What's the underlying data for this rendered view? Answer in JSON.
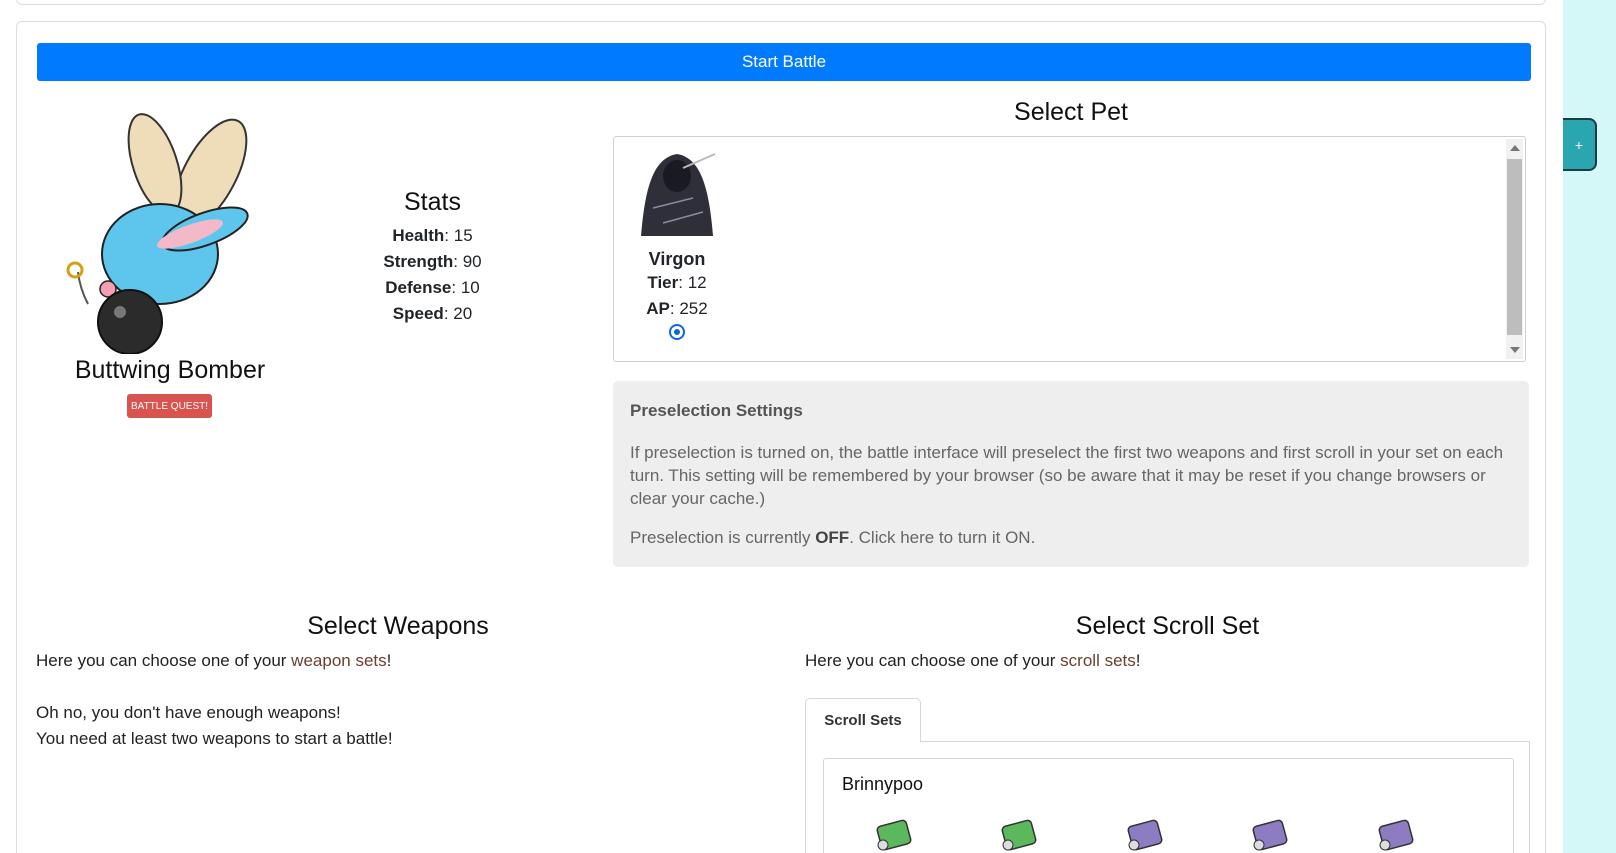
{
  "battle": {
    "start_label": "Start Battle"
  },
  "monster": {
    "name": "Buttwing Bomber",
    "quest_label": "BATTLE QUEST!",
    "stats_title": "Stats",
    "stats": [
      {
        "label": "Health",
        "value": "15"
      },
      {
        "label": "Strength",
        "value": "90"
      },
      {
        "label": "Defense",
        "value": "10"
      },
      {
        "label": "Speed",
        "value": "20"
      }
    ]
  },
  "pet_section": {
    "title": "Select Pet",
    "pets": [
      {
        "name": "Virgon",
        "tier_label": "Tier",
        "tier": "12",
        "ap_label": "AP",
        "ap": "252",
        "selected": true
      }
    ]
  },
  "preselection": {
    "title": "Preselection Settings",
    "description": "If preselection is turned on, the battle interface will preselect the first two weapons and first scroll in your set on each turn. This setting will be remembered by your browser (so be aware that it may be reset if you change browsers or clear your cache.)",
    "status_prefix": "Preselection is currently ",
    "status_value": "OFF",
    "status_suffix": ". Click here to turn it ON."
  },
  "weapons": {
    "title": "Select Weapons",
    "intro_prefix": "Here you can choose one of your ",
    "intro_link": "weapon sets",
    "intro_suffix": "!",
    "warning_line1": "Oh no, you don't have enough weapons!",
    "warning_line2": "You need at least two weapons to start a battle!"
  },
  "scrolls": {
    "title": "Select Scroll Set",
    "intro_prefix": "Here you can choose one of your ",
    "intro_link": "scroll sets",
    "intro_suffix": "!",
    "tab_label": "Scroll Sets",
    "set_name": "Brinnypoo",
    "scroll_colors": [
      "#5cb85c",
      "#5cb85c",
      "#8e7cc3",
      "#8e7cc3",
      "#8e7cc3"
    ]
  },
  "side_toggle": {
    "label": "+"
  },
  "colors": {
    "primary": "#007bff",
    "danger": "#d9534f",
    "accent": "#2aa6b0"
  }
}
